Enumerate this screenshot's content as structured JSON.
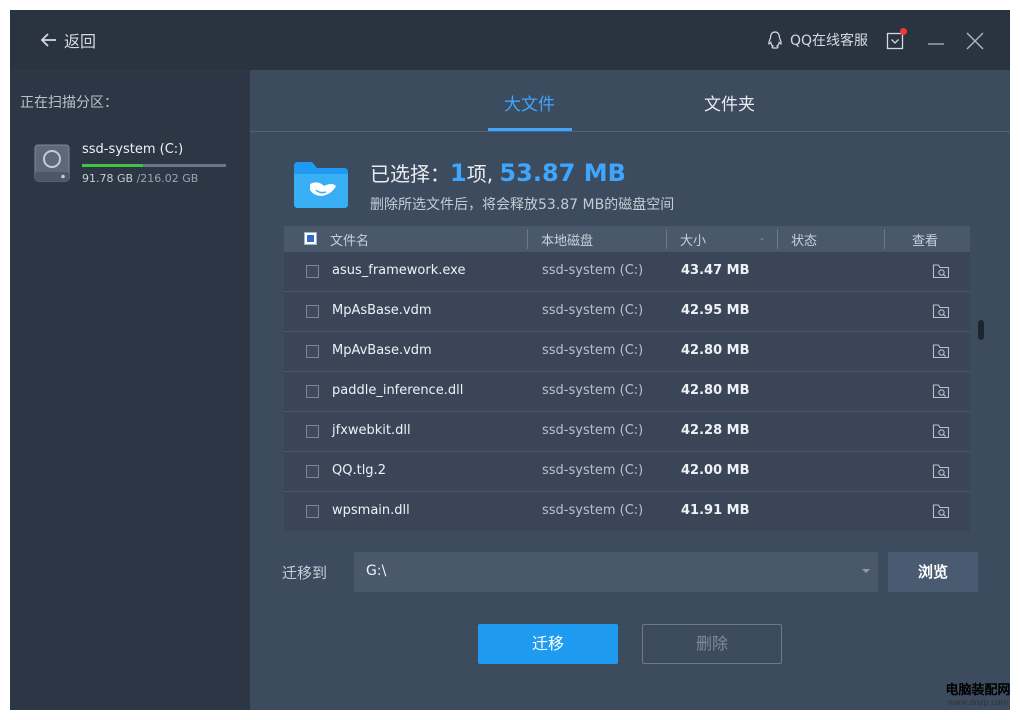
{
  "header": {
    "back_label": "返回",
    "qq_service_label": "QQ在线客服"
  },
  "sidebar": {
    "title": "正在扫描分区：",
    "drive": {
      "name": "ssd-system (C:)",
      "used": "91.78 GB",
      "total": "/216.02 GB",
      "used_fraction": 0.425
    }
  },
  "tabs": [
    {
      "label": "大文件",
      "active": true
    },
    {
      "label": "文件夹",
      "active": false
    }
  ],
  "summary": {
    "prefix": "已选择：",
    "count": "1",
    "count_unit": "项, ",
    "size": "53.87 MB",
    "note_prefix": "删除所选文件后，将会释放",
    "note_size": "53.87 MB",
    "note_suffix": "的磁盘空间"
  },
  "table": {
    "columns": {
      "name": "文件名",
      "disk": "本地磁盘",
      "size": "大小",
      "status": "状态",
      "view": "查看"
    },
    "rows": [
      {
        "name": "asus_framework.exe",
        "disk": "ssd-system (C:)",
        "size": "43.47 MB"
      },
      {
        "name": "MpAsBase.vdm",
        "disk": "ssd-system (C:)",
        "size": "42.95 MB"
      },
      {
        "name": "MpAvBase.vdm",
        "disk": "ssd-system (C:)",
        "size": "42.80 MB"
      },
      {
        "name": "paddle_inference.dll",
        "disk": "ssd-system (C:)",
        "size": "42.80 MB"
      },
      {
        "name": "jfxwebkit.dll",
        "disk": "ssd-system (C:)",
        "size": "42.28 MB"
      },
      {
        "name": "QQ.tlg.2",
        "disk": "ssd-system (C:)",
        "size": "42.00 MB"
      },
      {
        "name": "wpsmain.dll",
        "disk": "ssd-system (C:)",
        "size": "41.91 MB"
      }
    ]
  },
  "migrate": {
    "label": "迁移到",
    "path": "G:\\",
    "browse_label": "浏览"
  },
  "actions": {
    "migrate_label": "迁移",
    "delete_label": "删除"
  },
  "watermark": {
    "main": "电脑装配网",
    "sub": "www.dnzp.com"
  },
  "colors": {
    "accent": "#1e9bf0",
    "active_tab": "#3ea6ff",
    "progress": "#41c441",
    "sidebar_bg": "#2c3644",
    "main_bg": "#3d4b5e"
  }
}
